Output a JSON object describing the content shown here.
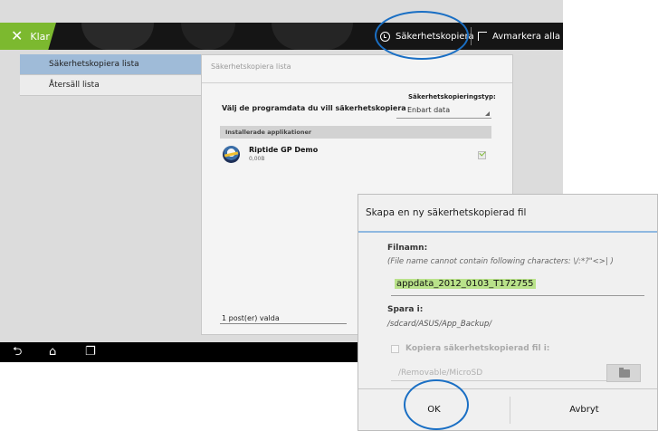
{
  "actionbar": {
    "done_label": "Klar",
    "done_icon": "close-icon",
    "backup_label": "Säkerhetskopiera",
    "backup_icon": "backup-clock-icon",
    "deselect_label": "Avmarkera alla",
    "deselect_icon": "deselect-icon",
    "accent_color": "#7cb92f"
  },
  "left_menu": {
    "items": [
      {
        "label": "Säkerhetskopiera lista",
        "selected": true
      },
      {
        "label": "Återsäll lista",
        "selected": false
      }
    ]
  },
  "main": {
    "title": "Säkerhetskopiera lista",
    "choose_label": "Välj de programdata du vill säkerhetskopiera",
    "type_label": "Säkerhetskopieringstyp:",
    "type_value": "Enbart data",
    "section_header": "Installerade applikationer",
    "apps": [
      {
        "name": "Riptide GP Demo",
        "size": "0,00B",
        "checked": true
      }
    ],
    "selected_count": "1 post(er) valda"
  },
  "navbar": {
    "back_icon": "back-icon",
    "home_icon": "home-icon",
    "recents_icon": "recent-apps-icon"
  },
  "dialog": {
    "title": "Skapa en ny säkerhetskopierad fil",
    "filename_label": "Filnamn:",
    "filename_hint": "(File name cannot contain following characters: \\/:*?\"<>| )",
    "filename_value": "appdata_2012_0103_T172755",
    "save_label": "Spara i:",
    "save_path": "/sdcard/ASUS/App_Backup/",
    "copy_label": "Kopiera säkerhetskopierad fil i:",
    "copy_checked": false,
    "copy_path": "/Removable/MicroSD",
    "folder_icon": "folder-search-icon",
    "ok_label": "OK",
    "cancel_label": "Avbryt"
  },
  "highlight_color": "#1a6fc4"
}
